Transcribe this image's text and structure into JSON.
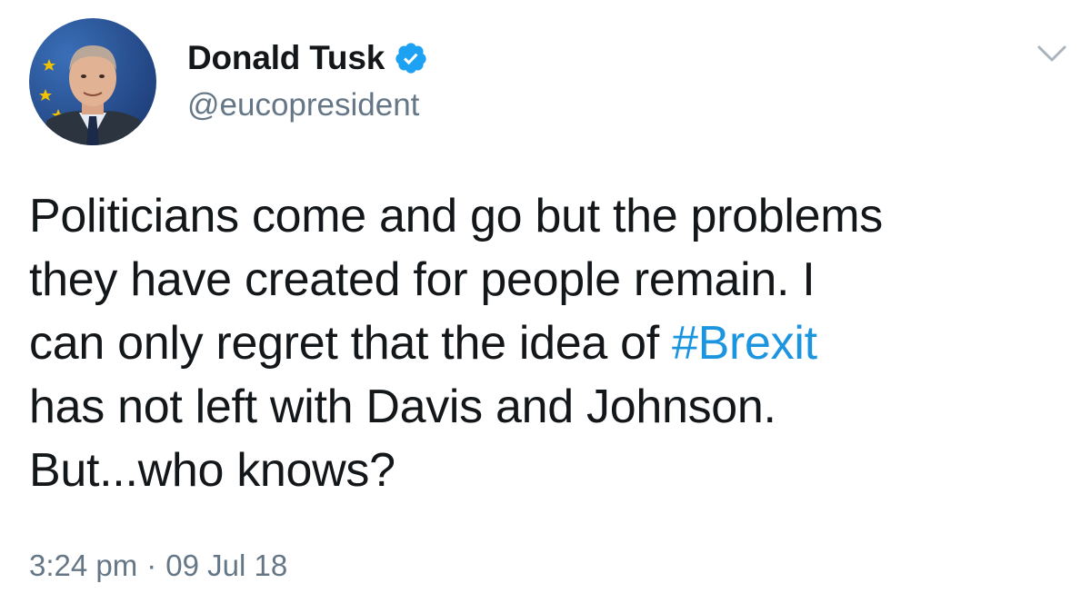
{
  "author": {
    "display_name": "Donald Tusk",
    "handle": "@eucopresident",
    "verified": true
  },
  "tweet": {
    "lines": [
      "Politicians come and go but the problems",
      "they have created for people remain. I",
      "can only regret that the idea of ",
      "has not left with Davis and Johnson.",
      "But...who knows?"
    ],
    "hashtag": "#Brexit"
  },
  "meta": {
    "time": "3:24 pm",
    "separator": "·",
    "date": "09 Jul 18"
  },
  "colors": {
    "text": "#14171a",
    "secondary": "#657786",
    "link": "#1b95e0",
    "verified": "#1da1f2"
  },
  "icons": {
    "verified": "verified-badge-icon",
    "menu": "chevron-down-icon"
  }
}
